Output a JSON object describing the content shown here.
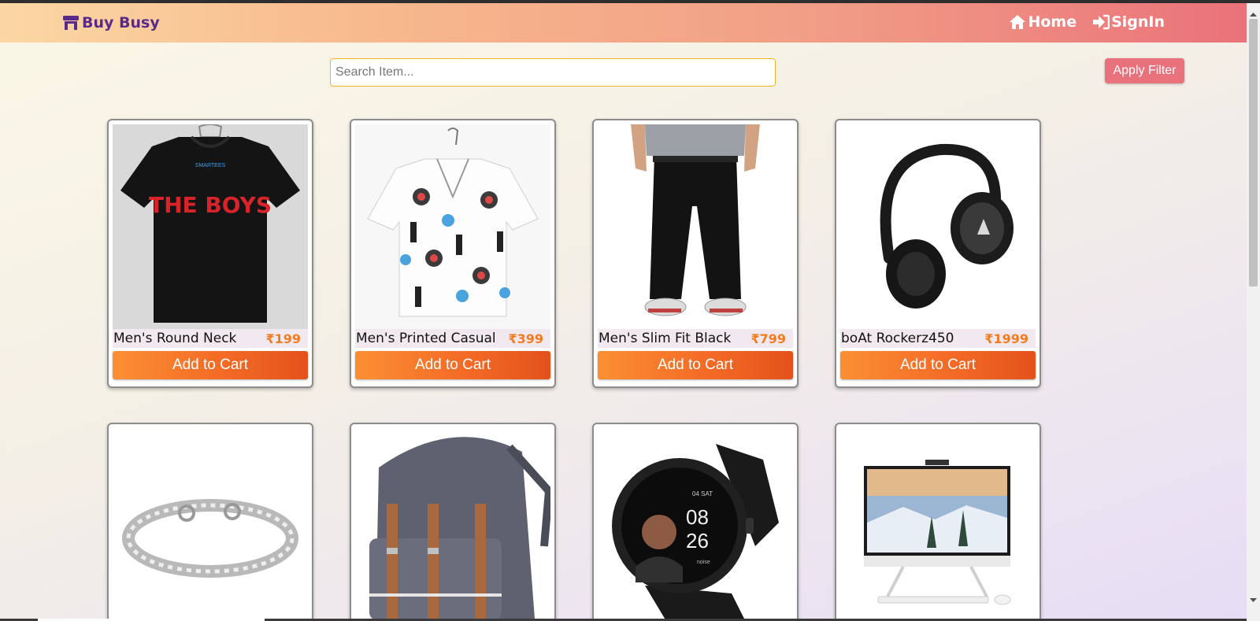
{
  "brand": {
    "name": "Buy Busy",
    "icon": "store-icon",
    "color": "#5a2a8a"
  },
  "nav": {
    "home": {
      "label": "Home",
      "icon": "home-icon"
    },
    "signin": {
      "label": "SignIn",
      "icon": "signin-icon"
    }
  },
  "search": {
    "placeholder": "Search Item...",
    "value": ""
  },
  "filter": {
    "label": "Apply Filter"
  },
  "products": [
    {
      "name": "Men's Round Neck",
      "price": "₹199",
      "button": "Add to Cart",
      "image": "black-tshirt-image"
    },
    {
      "name": "Men's Printed Casual",
      "price": "₹399",
      "button": "Add to Cart",
      "image": "printed-shirt-image"
    },
    {
      "name": "Men's Slim Fit Black",
      "price": "₹799",
      "button": "Add to Cart",
      "image": "black-jeans-image"
    },
    {
      "name": "boAt Rockerz450",
      "price": "₹1999",
      "button": "Add to Cart",
      "image": "headphones-image"
    },
    {
      "image": "bracelet-image"
    },
    {
      "image": "backpack-image"
    },
    {
      "image": "smartwatch-image"
    },
    {
      "image": "desktop-computer-image"
    }
  ],
  "tshirt_text": "THE BOYS",
  "tshirt_brand": "SMARTEES",
  "watch_face": {
    "day": "04 SAT",
    "hours": "08",
    "minutes": "26",
    "brand": "noise"
  },
  "colors": {
    "accent": "#f47c20",
    "filter": "#e8717b",
    "search_border": "#f0b429"
  }
}
